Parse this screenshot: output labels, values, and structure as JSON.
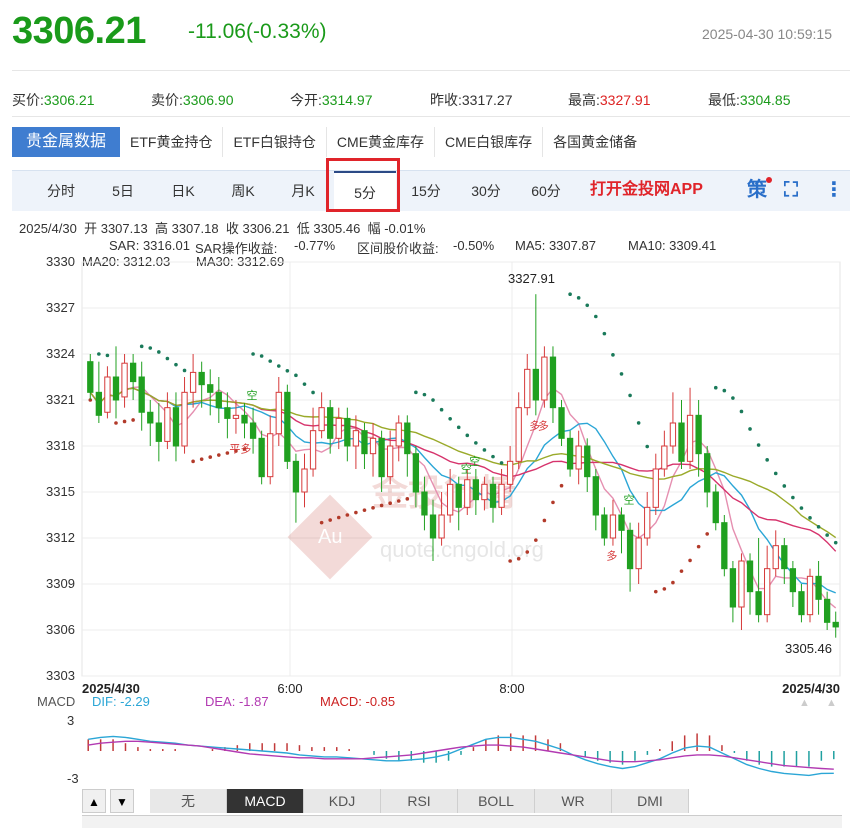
{
  "header": {
    "price": "3306.21",
    "change": "-11.06(-0.33%)",
    "datetime": "2025-04-30 10:59:15"
  },
  "quote": [
    {
      "label": "买价:",
      "value": "3306.21",
      "color": "#1a9a1a"
    },
    {
      "label": "卖价:",
      "value": "3306.90",
      "color": "#1a9a1a"
    },
    {
      "label": "今开:",
      "value": "3314.97",
      "color": "#1a9a1a"
    },
    {
      "label": "昨收:",
      "value": "3317.27",
      "color": "#333333"
    },
    {
      "label": "最高:",
      "value": "3327.91",
      "color": "#dd2222"
    },
    {
      "label": "最低:",
      "value": "3304.85",
      "color": "#1a9a1a"
    }
  ],
  "category_tabs": [
    "贵金属数据",
    "ETF黄金持仓",
    "ETF白银持仓",
    "CME黄金库存",
    "CME白银库存",
    "各国黄金储备"
  ],
  "period_tabs": [
    "分时",
    "5日",
    "日K",
    "周K",
    "月K",
    "5分",
    "15分",
    "30分",
    "60分"
  ],
  "active_period": "5分",
  "app_link": "打开金投网APP",
  "toolbar_icons": {
    "strategy": "策",
    "fullscreen": "⛶",
    "more": "⋮"
  },
  "ohlc": {
    "date": "2025/4/30",
    "open_label": "开",
    "open": "3307.13",
    "high_label": "高",
    "high": "3307.18",
    "close_label": "收",
    "close": "3306.21",
    "low_label": "低",
    "low": "3305.46",
    "amp_label": "幅",
    "amp": "-0.01%"
  },
  "indicators_line1": [
    {
      "text": "SAR: 3316.01",
      "color": "#888888"
    },
    {
      "text": "SAR操作收益:",
      "color": "#888888"
    },
    {
      "text": "-0.77%",
      "color": "#1a9a1a"
    },
    {
      "text": "区间股价收益:",
      "color": "#888888"
    },
    {
      "text": "-0.50%",
      "color": "#1a9a1a"
    },
    {
      "text": "MA5: 3307.87",
      "color": "#e58fb0"
    },
    {
      "text": "MA10: 3309.41",
      "color": "#2ba6d6"
    }
  ],
  "indicators_line2": [
    {
      "text": "MA20: 3312.03",
      "color": "#d6336c"
    },
    {
      "text": "MA30: 3312.69",
      "color": "#9aaa2a"
    }
  ],
  "chart": {
    "y_ticks": [
      "3330",
      "3327",
      "3324",
      "3321",
      "3318",
      "3315",
      "3312",
      "3309",
      "3306",
      "3303"
    ],
    "x_labels": [
      "2025/4/30",
      "6:00",
      "8:00",
      "2025/4/30"
    ],
    "high_label": "3327.91",
    "low_label": "3305.46",
    "signals": [
      "多",
      "空",
      "平多",
      "空",
      "多",
      "空",
      "多",
      "空"
    ],
    "watermark_main": "金投行情",
    "watermark_sub": "quote.cngold.org",
    "watermark_logo": "Au"
  },
  "chart_data": {
    "type": "candlestick",
    "x_labels": [
      "2025/4/30",
      "6:00",
      "8:00",
      "2025/4/30"
    ],
    "ylim": [
      3303,
      3330
    ],
    "y_ticks": [
      3330,
      3327,
      3324,
      3321,
      3318,
      3315,
      3312,
      3309,
      3306,
      3303
    ],
    "candles": [
      [
        3323.5,
        3321.5,
        3324.0,
        3321.0
      ],
      [
        3321.5,
        3320.0,
        3323.5,
        3319.5
      ],
      [
        3320.2,
        3322.5,
        3323.2,
        3319.8
      ],
      [
        3322.5,
        3321.0,
        3324.5,
        3319.8
      ],
      [
        3321.2,
        3323.4,
        3324.0,
        3320.5
      ],
      [
        3323.4,
        3322.2,
        3324.0,
        3321.0
      ],
      [
        3322.5,
        3320.2,
        3323.5,
        3319.0
      ],
      [
        3320.2,
        3319.5,
        3321.0,
        3318.0
      ],
      [
        3319.5,
        3318.3,
        3320.8,
        3317.0
      ],
      [
        3318.3,
        3320.5,
        3321.5,
        3317.8
      ],
      [
        3320.5,
        3318.0,
        3321.5,
        3317.0
      ],
      [
        3318.0,
        3321.5,
        3322.5,
        3317.5
      ],
      [
        3321.5,
        3322.8,
        3324.0,
        3320.5
      ],
      [
        3322.8,
        3322.0,
        3323.5,
        3320.5
      ],
      [
        3322.0,
        3321.5,
        3323.0,
        3320.0
      ],
      [
        3321.5,
        3320.5,
        3322.5,
        3319.5
      ],
      [
        3320.5,
        3319.8,
        3321.5,
        3318.5
      ],
      [
        3319.8,
        3320.0,
        3321.0,
        3318.8
      ],
      [
        3320.0,
        3319.5,
        3320.8,
        3318.5
      ],
      [
        3319.5,
        3318.5,
        3320.5,
        3317.5
      ],
      [
        3318.5,
        3316.0,
        3319.0,
        3315.5
      ],
      [
        3316.0,
        3318.8,
        3320.0,
        3315.5
      ],
      [
        3318.8,
        3321.5,
        3322.5,
        3318.0
      ],
      [
        3321.5,
        3317.0,
        3322.0,
        3316.5
      ],
      [
        3317.0,
        3315.0,
        3317.5,
        3313.0
      ],
      [
        3315.0,
        3316.5,
        3317.5,
        3314.0
      ],
      [
        3316.5,
        3319.0,
        3320.5,
        3316.0
      ],
      [
        3319.0,
        3320.5,
        3321.5,
        3318.5
      ],
      [
        3320.5,
        3318.5,
        3321.0,
        3317.5
      ],
      [
        3318.5,
        3319.8,
        3320.5,
        3317.8
      ],
      [
        3319.8,
        3318.0,
        3320.5,
        3317.0
      ],
      [
        3318.0,
        3319.0,
        3320.0,
        3316.5
      ],
      [
        3319.0,
        3317.5,
        3319.5,
        3316.5
      ],
      [
        3317.5,
        3318.5,
        3319.5,
        3316.0
      ],
      [
        3318.5,
        3316.0,
        3319.0,
        3315.0
      ],
      [
        3316.0,
        3318.0,
        3319.0,
        3315.5
      ],
      [
        3318.0,
        3319.5,
        3320.0,
        3317.0
      ],
      [
        3319.5,
        3317.5,
        3320.0,
        3316.0
      ],
      [
        3317.5,
        3315.0,
        3318.0,
        3314.0
      ],
      [
        3315.0,
        3313.5,
        3316.0,
        3312.5
      ],
      [
        3313.5,
        3312.0,
        3314.5,
        3310.5
      ],
      [
        3312.0,
        3313.5,
        3315.0,
        3311.5
      ],
      [
        3313.5,
        3315.5,
        3316.5,
        3313.0
      ],
      [
        3315.5,
        3314.0,
        3316.0,
        3312.5
      ],
      [
        3314.0,
        3315.8,
        3316.5,
        3313.5
      ],
      [
        3315.8,
        3314.5,
        3316.5,
        3313.5
      ],
      [
        3314.5,
        3315.5,
        3316.0,
        3313.8
      ],
      [
        3315.5,
        3314.0,
        3316.0,
        3313.0
      ],
      [
        3314.0,
        3315.5,
        3316.5,
        3313.5
      ],
      [
        3315.5,
        3317.0,
        3318.0,
        3315.0
      ],
      [
        3317.0,
        3320.5,
        3321.5,
        3316.5
      ],
      [
        3320.5,
        3323.0,
        3324.0,
        3320.0
      ],
      [
        3323.0,
        3321.0,
        3327.9,
        3320.0
      ],
      [
        3321.0,
        3323.8,
        3324.5,
        3320.5
      ],
      [
        3323.8,
        3320.5,
        3324.5,
        3319.5
      ],
      [
        3320.5,
        3318.5,
        3321.0,
        3318.0
      ],
      [
        3318.5,
        3316.5,
        3319.0,
        3316.0
      ],
      [
        3316.5,
        3318.0,
        3319.0,
        3315.5
      ],
      [
        3318.0,
        3316.0,
        3318.5,
        3315.0
      ],
      [
        3316.0,
        3313.5,
        3316.5,
        3312.5
      ],
      [
        3313.5,
        3312.0,
        3314.0,
        3311.5
      ],
      [
        3312.0,
        3313.5,
        3314.5,
        3311.5
      ],
      [
        3313.5,
        3312.5,
        3314.0,
        3311.0
      ],
      [
        3312.5,
        3310.0,
        3313.0,
        3308.5
      ],
      [
        3310.0,
        3312.0,
        3313.0,
        3309.0
      ],
      [
        3312.0,
        3314.0,
        3315.0,
        3311.5
      ],
      [
        3314.0,
        3316.5,
        3317.5,
        3313.5
      ],
      [
        3316.5,
        3318.0,
        3319.0,
        3316.0
      ],
      [
        3318.0,
        3319.5,
        3321.5,
        3317.5
      ],
      [
        3319.5,
        3317.0,
        3321.0,
        3316.5
      ],
      [
        3317.0,
        3320.0,
        3321.8,
        3316.5
      ],
      [
        3320.0,
        3317.5,
        3321.0,
        3316.0
      ],
      [
        3317.5,
        3315.0,
        3318.0,
        3314.0
      ],
      [
        3315.0,
        3313.0,
        3315.5,
        3312.5
      ],
      [
        3313.0,
        3310.0,
        3313.5,
        3309.5
      ],
      [
        3310.0,
        3307.5,
        3310.5,
        3306.5
      ],
      [
        3307.5,
        3310.5,
        3311.0,
        3306.0
      ],
      [
        3310.5,
        3308.5,
        3311.0,
        3307.0
      ],
      [
        3308.5,
        3307.0,
        3312.0,
        3306.5
      ],
      [
        3307.0,
        3310.0,
        3311.5,
        3306.5
      ],
      [
        3310.0,
        3311.5,
        3312.5,
        3309.5
      ],
      [
        3311.5,
        3310.0,
        3312.0,
        3309.0
      ],
      [
        3310.0,
        3308.5,
        3310.5,
        3307.5
      ],
      [
        3308.5,
        3307.0,
        3309.0,
        3306.5
      ],
      [
        3307.0,
        3309.5,
        3310.0,
        3306.5
      ],
      [
        3309.5,
        3308.0,
        3310.5,
        3307.0
      ],
      [
        3308.0,
        3306.5,
        3308.5,
        3306.0
      ],
      [
        3306.5,
        3306.2,
        3307.2,
        3305.5
      ]
    ],
    "series": [
      {
        "name": "MA5",
        "color": "#e58fb0"
      },
      {
        "name": "MA10",
        "color": "#2ba6d6"
      },
      {
        "name": "MA20",
        "color": "#d6336c"
      },
      {
        "name": "MA30",
        "color": "#9aaa2a"
      },
      {
        "name": "SAR",
        "color": "#1a7a5a"
      }
    ],
    "macd": {
      "labels": {
        "macd": "MACD",
        "dif": "DIF: -2.29",
        "dea": "DEA: -1.87",
        "hist": "MACD: -0.85"
      },
      "y_ticks": [
        "3",
        "-3"
      ],
      "ylim": [
        -4,
        4
      ],
      "dif": [
        1.2,
        1.4,
        1.5,
        1.4,
        1.2,
        1.0,
        0.9,
        0.8,
        0.6,
        0.5,
        0.4,
        0.3,
        0.2,
        0.1,
        0.0,
        -0.1,
        -0.2,
        -0.4,
        -0.5,
        -0.6,
        -0.6,
        -0.7,
        -0.8,
        -0.9,
        -1.0,
        -1.0,
        -0.9,
        -0.8,
        -0.6,
        -0.3,
        0.2,
        0.7,
        1.2,
        1.4,
        1.4,
        1.2,
        1.0,
        0.6,
        0.2,
        -0.4,
        -0.9,
        -1.3,
        -1.6,
        -1.8,
        -1.6,
        -1.2,
        -0.8,
        -0.2,
        0.3,
        0.5,
        0.4,
        -0.2,
        -0.8,
        -1.4,
        -1.8,
        -2.1,
        -2.3,
        -2.4,
        -2.5,
        -2.3,
        -2.29
      ],
      "dea": [
        0.6,
        0.8,
        0.9,
        1.0,
        1.0,
        0.9,
        0.8,
        0.7,
        0.6,
        0.5,
        0.3,
        0.1,
        -0.1,
        -0.3,
        -0.4,
        -0.5,
        -0.6,
        -0.7,
        -0.7,
        -0.8,
        -0.8,
        -0.8,
        -0.8,
        -0.7,
        -0.6,
        -0.5,
        -0.4,
        -0.2,
        0.0,
        0.2,
        0.4,
        0.5,
        0.6,
        0.6,
        0.5,
        0.4,
        0.2,
        0.0,
        -0.2,
        -0.4,
        -0.6,
        -0.8,
        -1.0,
        -1.1,
        -1.1,
        -1.0,
        -0.9,
        -0.7,
        -0.5,
        -0.4,
        -0.4,
        -0.5,
        -0.7,
        -0.9,
        -1.1,
        -1.3,
        -1.5,
        -1.6,
        -1.7,
        -1.8,
        -1.87
      ]
    }
  },
  "bottom_tabs": [
    "无",
    "MACD",
    "KDJ",
    "RSI",
    "BOLL",
    "WR",
    "DMI"
  ],
  "active_bottom_tab": "MACD",
  "scroll_arrows": {
    "up": "▲",
    "down": "▼"
  },
  "colors": {
    "up": "#d63a3a",
    "down": "#20a020",
    "accent": "#3f7dd0",
    "highlight_box": "#e0242a"
  }
}
